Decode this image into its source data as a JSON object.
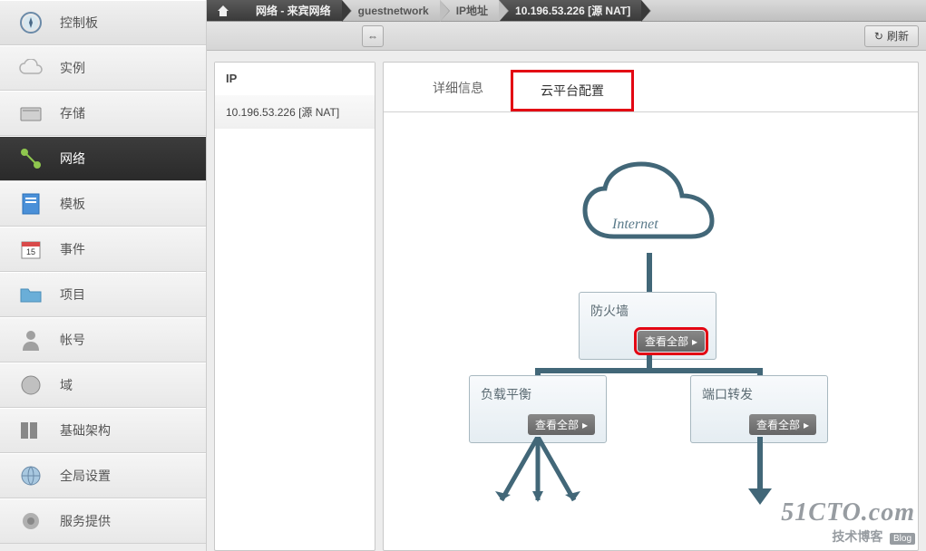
{
  "sidebar": {
    "items": [
      {
        "label": "控制板",
        "icon": "compass-icon"
      },
      {
        "label": "实例",
        "icon": "cloud-icon"
      },
      {
        "label": "存储",
        "icon": "disk-icon"
      },
      {
        "label": "网络",
        "icon": "network-icon",
        "active": true
      },
      {
        "label": "模板",
        "icon": "template-icon"
      },
      {
        "label": "事件",
        "icon": "calendar-icon"
      },
      {
        "label": "项目",
        "icon": "folder-icon"
      },
      {
        "label": "帐号",
        "icon": "user-icon"
      },
      {
        "label": "域",
        "icon": "domain-icon"
      },
      {
        "label": "基础架构",
        "icon": "servers-icon"
      },
      {
        "label": "全局设置",
        "icon": "globe-icon"
      },
      {
        "label": "服务提供",
        "icon": "gear-icon"
      }
    ]
  },
  "breadcrumb": {
    "items": [
      {
        "label": "网络 - 来宾网络"
      },
      {
        "label": "guestnetwork"
      },
      {
        "label": "IP地址"
      },
      {
        "label": "10.196.53.226 [源 NAT]"
      }
    ]
  },
  "toolbar": {
    "refresh_label": "刷新"
  },
  "left_panel": {
    "header": "IP",
    "items": [
      "10.196.53.226 [源 NAT]"
    ]
  },
  "tabs": {
    "items": [
      {
        "label": "详细信息"
      },
      {
        "label": "云平台配置",
        "active": true,
        "highlighted": true
      }
    ]
  },
  "diagram": {
    "cloud_label": "Internet",
    "firewall": {
      "title": "防火墙",
      "button": "查看全部",
      "highlighted": true
    },
    "loadbalance": {
      "title": "负载平衡",
      "button": "查看全部"
    },
    "portforward": {
      "title": "端口转发",
      "button": "查看全部"
    }
  },
  "watermark": {
    "main": "51CTO.com",
    "sub": "技术博客",
    "blog": "Blog"
  }
}
